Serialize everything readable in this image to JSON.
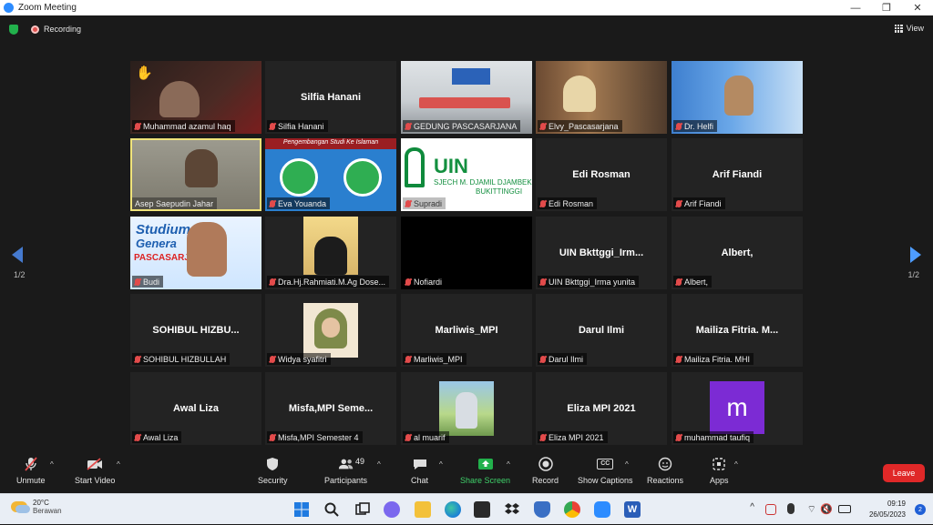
{
  "window": {
    "title": "Zoom Meeting",
    "minimize": "—",
    "restore": "❐",
    "close": "✕"
  },
  "topbar": {
    "recording_label": "Recording",
    "view_label": "View"
  },
  "pagination": {
    "left": "1/2",
    "right": "1/2"
  },
  "tiles": [
    {
      "display": "Muhammad azamul haq"
    },
    {
      "display": "Silfia Hanani",
      "center": "Silfia Hanani"
    },
    {
      "display": "GEDUNG PASCASARJANA"
    },
    {
      "display": "Elvy_Pascasarjana"
    },
    {
      "display": "Dr. Helfi"
    },
    {
      "display": "Asep Saepudin Jahar"
    },
    {
      "display": "Eva Youanda",
      "slide_text": "Pengembangan Studi Ke Islaman"
    },
    {
      "display": "Supradi",
      "logo_text": "UIN",
      "logo_sub": "SJECH M. DJAMIL DJAMBEK",
      "logo_sub2": "BUKITTINGGI"
    },
    {
      "display": "Edi Rosman",
      "center": "Edi Rosman"
    },
    {
      "display": "Arif Fiandi",
      "center": "Arif Fiandi"
    },
    {
      "display": "Budi",
      "banner1": "Studium",
      "banner2": "Genera",
      "banner3": "PASCASARJ"
    },
    {
      "display": "Dra.Hj.Rahmiati.M.Ag Dose..."
    },
    {
      "display": "Nofiardi"
    },
    {
      "display": "UIN Bkttggi_Irma yunita",
      "center": "UIN Bkttggi_Irm..."
    },
    {
      "display": "Albert,",
      "center": "Albert,"
    },
    {
      "display": "SOHIBUL HIZBULLAH",
      "center": "SOHIBUL HIZBU..."
    },
    {
      "display": "Widya syafitri"
    },
    {
      "display": "Marliwis_MPI",
      "center": "Marliwis_MPI"
    },
    {
      "display": "Darul Ilmi",
      "center": "Darul Ilmi"
    },
    {
      "display": "Mailiza Fitria. MHI",
      "center": "Mailiza Fitria. M..."
    },
    {
      "display": "Awal Liza",
      "center": "Awal Liza"
    },
    {
      "display": "Misfa,MPI Semester 4",
      "center": "Misfa,MPI Seme..."
    },
    {
      "display": "al muarif"
    },
    {
      "display": "Eliza MPI 2021",
      "center": "Eliza MPI 2021"
    },
    {
      "display": "muhammad taufiq",
      "avatar_letter": "m"
    }
  ],
  "toolbar": {
    "unmute": "Unmute",
    "start_video": "Start Video",
    "security": "Security",
    "participants": "Participants",
    "participants_count": "49",
    "chat": "Chat",
    "share_screen": "Share Screen",
    "record": "Record",
    "show_captions": "Show Captions",
    "captions_icon": "CC",
    "reactions": "Reactions",
    "apps": "Apps",
    "leave": "Leave"
  },
  "taskbar": {
    "temp": "20°C",
    "weather": "Berawan",
    "time": "09:19",
    "date": "26/05/2023",
    "notifications": "2",
    "word_icon": "W"
  },
  "colors": {
    "accent": "#2d8cff",
    "leave": "#e02828",
    "share": "#22b14c",
    "mic_off": "#e24b4b",
    "active_speaker": "#f0e37a",
    "avatar_m": "#7c2bd4"
  }
}
